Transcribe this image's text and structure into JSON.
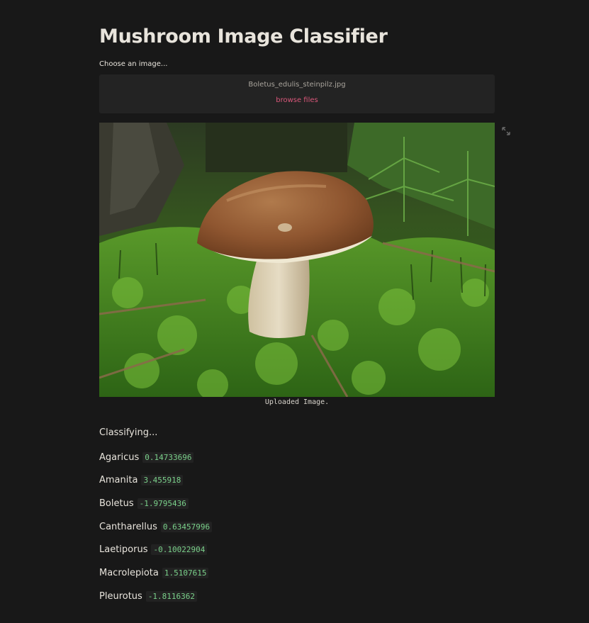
{
  "page": {
    "title": "Mushroom Image Classifier"
  },
  "uploader": {
    "label": "Choose an image...",
    "file_name": "Boletus_edulis_steinpilz.jpg",
    "browse_label": "browse files"
  },
  "image": {
    "caption": "Uploaded Image."
  },
  "status_text": "Classifying...",
  "results": [
    {
      "name": "Agaricus",
      "score": "0.14733696"
    },
    {
      "name": "Amanita",
      "score": "3.455918"
    },
    {
      "name": "Boletus",
      "score": "-1.9795436"
    },
    {
      "name": "Cantharellus",
      "score": "0.63457996"
    },
    {
      "name": "Laetiporus",
      "score": "-0.10022904"
    },
    {
      "name": "Macrolepiota",
      "score": "1.5107615"
    },
    {
      "name": "Pleurotus",
      "score": "-1.8116362"
    }
  ],
  "colors": {
    "background": "#181818",
    "text": "#e8e4dc",
    "accent_link": "#d9577a",
    "score_text": "#7ad08a",
    "dropzone": "#232323"
  },
  "icons": {
    "expand": "expand-icon"
  }
}
